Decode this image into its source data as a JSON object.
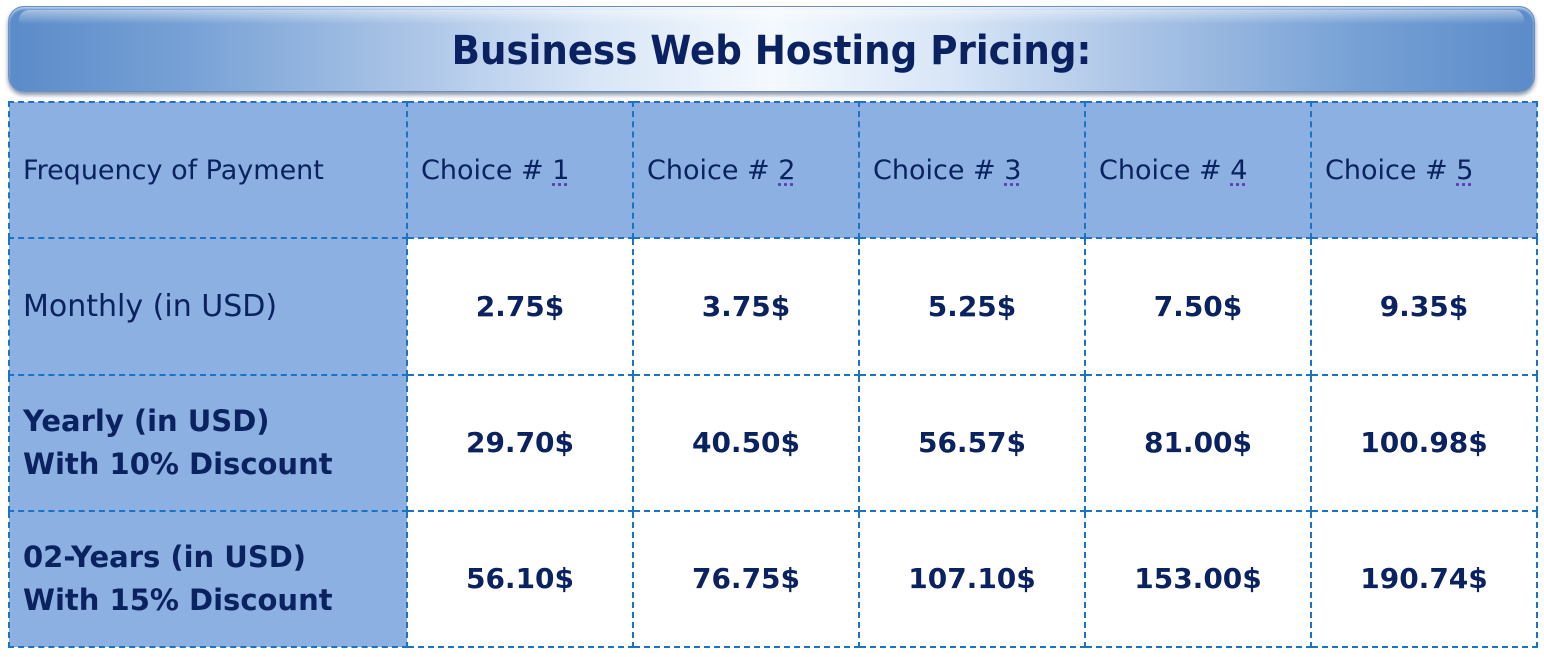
{
  "title": "Business Web Hosting Pricing:",
  "colors": {
    "title_text": "#0a2162",
    "header_bg": "#8cb0e1",
    "border": "#1a73c4",
    "text": "#0b2260"
  },
  "table": {
    "header": {
      "label": "Frequency of Payment",
      "choices": [
        {
          "prefix": "Choice # ",
          "number": "1"
        },
        {
          "prefix": "Choice # ",
          "number": "2"
        },
        {
          "prefix": "Choice # ",
          "number": "3"
        },
        {
          "prefix": "Choice # ",
          "number": "4"
        },
        {
          "prefix": "Choice # ",
          "number": "5"
        }
      ]
    },
    "rows": [
      {
        "label_line1": "Monthly (in USD)",
        "label_line2": "",
        "prices": [
          "2.75$",
          "3.75$",
          "5.25$",
          "7.50$",
          "9.35$"
        ]
      },
      {
        "label_line1": "Yearly (in USD)",
        "label_line2": "With 10% Discount",
        "prices": [
          "29.70$",
          "40.50$",
          "56.57$",
          "81.00$",
          "100.98$"
        ]
      },
      {
        "label_line1": "02-Years (in USD)",
        "label_line2": "With 15% Discount",
        "prices": [
          "56.10$",
          "76.75$",
          "107.10$",
          "153.00$",
          "190.74$"
        ]
      }
    ]
  }
}
